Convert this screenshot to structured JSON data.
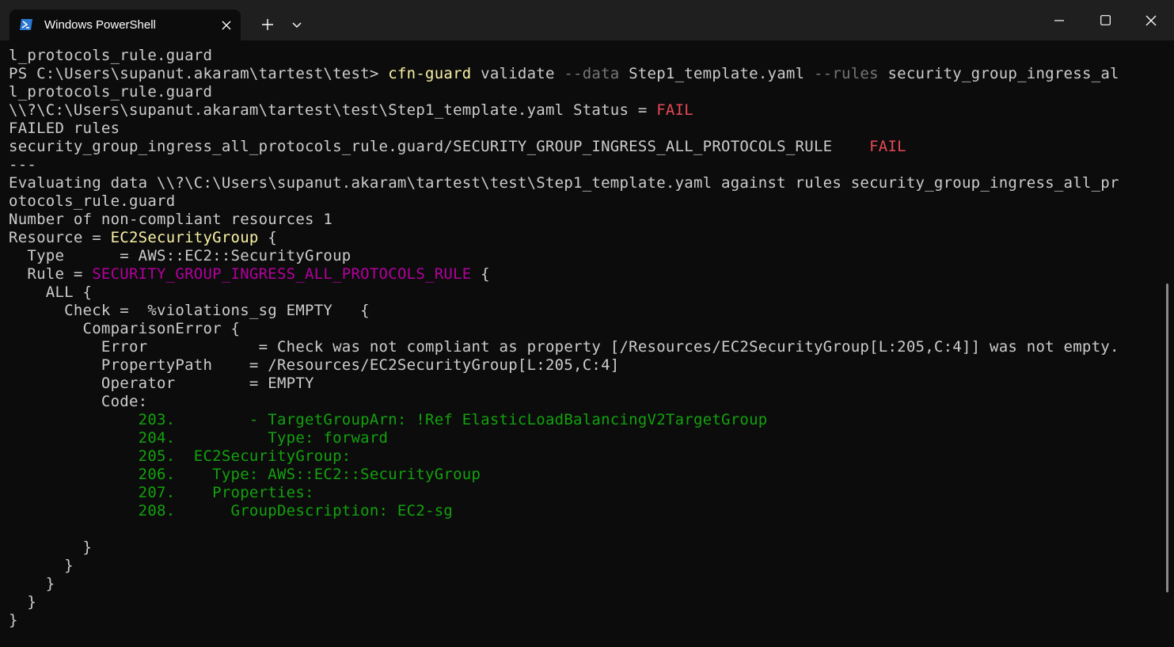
{
  "window": {
    "tab_title": "Windows PowerShell",
    "tab_icon": "powershell-icon",
    "new_tab_icon": "plus-icon",
    "dropdown_icon": "chevron-down-icon",
    "controls": [
      "minimize-icon",
      "maximize-icon",
      "close-icon"
    ]
  },
  "colors": {
    "background": "#0c0c0c",
    "titlebar": "#1f1f1f",
    "text": "#cccccc",
    "yellow": "#f9f1a5",
    "red": "#e74856",
    "magenta": "#b4009e",
    "green": "#13a10e",
    "gray": "#767676"
  },
  "terminal": {
    "lines": [
      {
        "segments": [
          {
            "text": "l_protocols_rule.guard"
          }
        ]
      },
      {
        "segments": [
          {
            "text": "PS C:\\Users\\supanut.akaram\\tartest\\test> "
          },
          {
            "text": "cfn-guard",
            "color": "yellow"
          },
          {
            "text": " validate "
          },
          {
            "text": "--data",
            "color": "gray"
          },
          {
            "text": " Step1_template.yaml "
          },
          {
            "text": "--rules",
            "color": "gray"
          },
          {
            "text": " security_group_ingress_al"
          }
        ]
      },
      {
        "segments": [
          {
            "text": "l_protocols_rule.guard"
          }
        ]
      },
      {
        "segments": [
          {
            "text": "\\\\?\\C:\\Users\\supanut.akaram\\tartest\\test\\Step1_template.yaml Status = "
          },
          {
            "text": "FAIL",
            "color": "red"
          }
        ]
      },
      {
        "segments": [
          {
            "text": "FAILED rules"
          }
        ]
      },
      {
        "segments": [
          {
            "text": "security_group_ingress_all_protocols_rule.guard/SECURITY_GROUP_INGRESS_ALL_PROTOCOLS_RULE    "
          },
          {
            "text": "FAIL",
            "color": "red"
          }
        ]
      },
      {
        "segments": [
          {
            "text": "---"
          }
        ]
      },
      {
        "segments": [
          {
            "text": "Evaluating data \\\\?\\C:\\Users\\supanut.akaram\\tartest\\test\\Step1_template.yaml against rules security_group_ingress_all_pr"
          }
        ]
      },
      {
        "segments": [
          {
            "text": "otocols_rule.guard"
          }
        ]
      },
      {
        "segments": [
          {
            "text": "Number of non-compliant resources 1"
          }
        ]
      },
      {
        "segments": [
          {
            "text": "Resource = "
          },
          {
            "text": "EC2SecurityGroup",
            "color": "yellow"
          },
          {
            "text": " {"
          }
        ]
      },
      {
        "segments": [
          {
            "text": "  Type      = AWS::EC2::SecurityGroup"
          }
        ]
      },
      {
        "segments": [
          {
            "text": "  Rule = "
          },
          {
            "text": "SECURITY_GROUP_INGRESS_ALL_PROTOCOLS_RULE",
            "color": "magenta"
          },
          {
            "text": " {"
          }
        ]
      },
      {
        "segments": [
          {
            "text": "    ALL {"
          }
        ]
      },
      {
        "segments": [
          {
            "text": "      Check =  %violations_sg EMPTY   {"
          }
        ]
      },
      {
        "segments": [
          {
            "text": "        ComparisonError {"
          }
        ]
      },
      {
        "segments": [
          {
            "text": "          Error            = Check was not compliant as property [/Resources/EC2SecurityGroup[L:205,C:4]] was not empty."
          }
        ]
      },
      {
        "segments": [
          {
            "text": "          PropertyPath    = /Resources/EC2SecurityGroup[L:205,C:4]"
          }
        ]
      },
      {
        "segments": [
          {
            "text": "          Operator        = EMPTY"
          }
        ]
      },
      {
        "segments": [
          {
            "text": "          Code:"
          }
        ]
      },
      {
        "segments": [
          {
            "text": "              203.        - TargetGroupArn: !Ref ElasticLoadBalancingV2TargetGroup",
            "color": "green"
          }
        ]
      },
      {
        "segments": [
          {
            "text": "              204.          Type: forward",
            "color": "green"
          }
        ]
      },
      {
        "segments": [
          {
            "text": "              205.  EC2SecurityGroup:",
            "color": "green"
          }
        ]
      },
      {
        "segments": [
          {
            "text": "              206.    Type: AWS::EC2::SecurityGroup",
            "color": "green"
          }
        ]
      },
      {
        "segments": [
          {
            "text": "              207.    Properties:",
            "color": "green"
          }
        ]
      },
      {
        "segments": [
          {
            "text": "              208.      GroupDescription: EC2-sg",
            "color": "green"
          }
        ]
      },
      {
        "segments": [
          {
            "text": ""
          }
        ]
      },
      {
        "segments": [
          {
            "text": "        }"
          }
        ]
      },
      {
        "segments": [
          {
            "text": "      }"
          }
        ]
      },
      {
        "segments": [
          {
            "text": "    }"
          }
        ]
      },
      {
        "segments": [
          {
            "text": "  }"
          }
        ]
      },
      {
        "segments": [
          {
            "text": "}"
          }
        ]
      }
    ]
  }
}
